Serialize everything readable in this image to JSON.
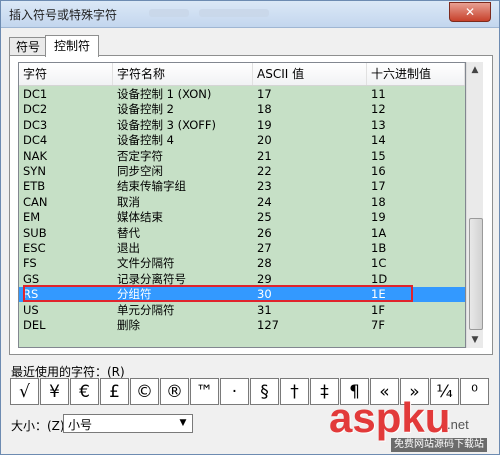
{
  "window": {
    "title": "插入符号或特殊字符",
    "close_label": "✕"
  },
  "tabs": [
    {
      "label": "符号",
      "active": false
    },
    {
      "label": "控制符",
      "active": true
    }
  ],
  "table": {
    "columns": [
      "字符",
      "字符名称",
      "ASCII 值",
      "十六进制值"
    ],
    "rows": [
      [
        "DC1",
        "设备控制 1 (XON)",
        "17",
        "11"
      ],
      [
        "DC2",
        "设备控制 2",
        "18",
        "12"
      ],
      [
        "DC3",
        "设备控制 3 (XOFF)",
        "19",
        "13"
      ],
      [
        "DC4",
        "设备控制 4",
        "20",
        "14"
      ],
      [
        "NAK",
        "否定字符",
        "21",
        "15"
      ],
      [
        "SYN",
        "同步空闲",
        "22",
        "16"
      ],
      [
        "ETB",
        "结束传输字组",
        "23",
        "17"
      ],
      [
        "CAN",
        "取消",
        "24",
        "18"
      ],
      [
        "EM",
        "媒体结束",
        "25",
        "19"
      ],
      [
        "SUB",
        "替代",
        "26",
        "1A"
      ],
      [
        "ESC",
        "退出",
        "27",
        "1B"
      ],
      [
        "FS",
        "文件分隔符",
        "28",
        "1C"
      ],
      [
        "GS",
        "记录分离符号",
        "29",
        "1D"
      ],
      [
        "RS",
        "分组符",
        "30",
        "1E"
      ],
      [
        "US",
        "单元分隔符",
        "31",
        "1F"
      ],
      [
        "DEL",
        "删除",
        "127",
        "7F"
      ]
    ],
    "selected_row": 13
  },
  "recent": {
    "label": "最近使用的字符：(R)",
    "symbols": [
      "√",
      "¥",
      "€",
      "£",
      "©",
      "®",
      "™",
      "·",
      "§",
      "†",
      "‡",
      "¶",
      "«",
      "»",
      "¼",
      "⁰"
    ]
  },
  "size": {
    "label": "大小：(Z)",
    "value": "小号"
  },
  "watermark": {
    "brand": "aspku",
    "suffix": ".net",
    "sub": "免费网站源码下载站"
  },
  "colors": {
    "list_bg": "#c6e0c6",
    "selection": "#3399ff",
    "highlight_box": "#e0242c"
  }
}
